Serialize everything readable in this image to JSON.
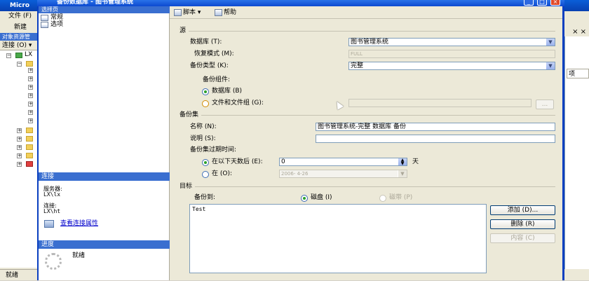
{
  "bg_app": {
    "title": "Micro",
    "menu": "文件 (F)",
    "toolbar_label": "新建",
    "status": "就绪",
    "explorer_title": "对象资源管",
    "connect_label": "连接 (O) ▾",
    "tree_root": "LX",
    "right_close": "× ×",
    "right_tab": "项"
  },
  "dialog": {
    "title": "备份数据库 - 图书管理系统",
    "select_page_header": "选择页",
    "pages": [
      {
        "label": "常规"
      },
      {
        "label": "选项"
      }
    ],
    "connection": {
      "header": "连接",
      "server_label": "服务器:",
      "server_value": "LX\\lx",
      "conn_label": "连接:",
      "conn_value": "LX\\ht",
      "view_props": "查看连接属性"
    },
    "progress": {
      "header": "进度",
      "status": "就绪"
    },
    "toolbar": {
      "script": "脚本 ▾",
      "help": "帮助"
    },
    "source": {
      "section": "源",
      "database_label": "数据库 (T):",
      "database_value": "图书管理系统",
      "recovery_label": "恢复模式 (M):",
      "recovery_value": "FULL",
      "backup_type_label": "备份类型 (K):",
      "backup_type_value": "完整",
      "component_label": "备份组件:",
      "opt_database": "数据库 (B)",
      "opt_files": "文件和文件组 (G):",
      "browse": "..."
    },
    "backup_set": {
      "section": "备份集",
      "name_label": "名称 (N):",
      "name_value": "图书管理系统-完整 数据库 备份",
      "desc_label": "说明 (S):",
      "desc_value": "",
      "expire_label": "备份集过期时间:",
      "opt_after": "在以下天数后 (E):",
      "days_value": "0",
      "days_unit": "天",
      "opt_on": "在 (O):",
      "date_value": "2006- 4-26"
    },
    "destination": {
      "section": "目标",
      "backup_to_label": "备份到:",
      "opt_disk": "磁盘 (I)",
      "opt_tape": "磁带 (P)",
      "items": [
        "Test"
      ],
      "add": "添加 (D)...",
      "remove": "删除 (R)",
      "contents": "内容 (C)"
    }
  }
}
